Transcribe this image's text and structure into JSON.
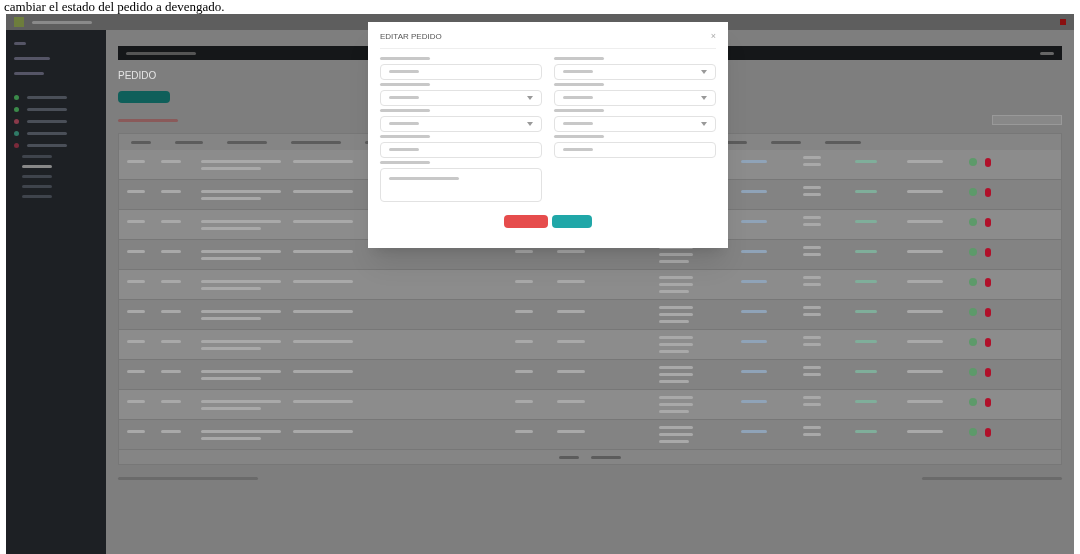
{
  "caption": "cambiar el estado del pedido a devengado.",
  "page": {
    "heading": "PEDIDO"
  },
  "modal": {
    "title": "EDITAR PEDIDO",
    "close": "×"
  }
}
